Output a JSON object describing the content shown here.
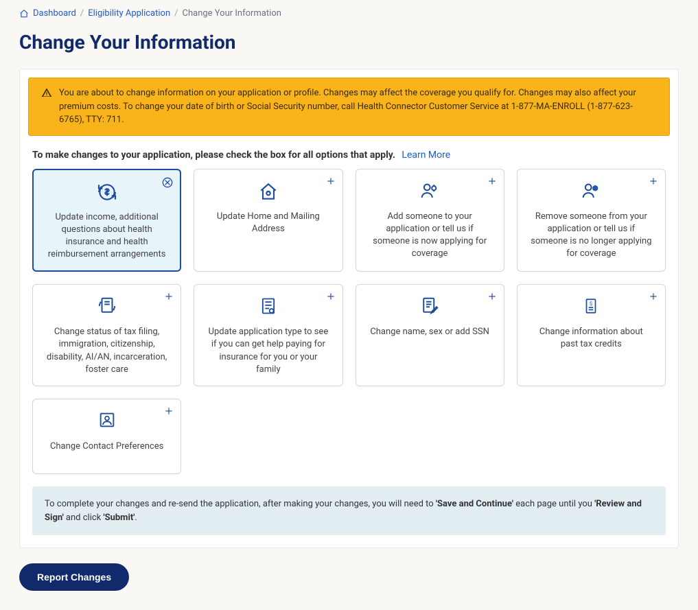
{
  "breadcrumb": {
    "dashboard": "Dashboard",
    "eligibility": "Eligibility Application",
    "current": "Change Your Information"
  },
  "title": "Change Your Information",
  "alert_text": "You are about to change information on your application or profile. Changes may affect the coverage you qualify for. Changes may also affect your premium costs. To change your date of birth or Social Security number, call Health Connector Customer Service at 1-877-MA-ENROLL (1-877-623-6765), TTY: 711.",
  "instructions": "To make changes to your application, please check the box for all options that apply.",
  "learn_more": "Learn More",
  "cards": {
    "income": "Update income, additional questions about health insurance and health reimbursement arrangements",
    "address": "Update Home and Mailing Address",
    "add_person": "Add someone to your application or tell us if someone is now applying for coverage",
    "remove_person": "Remove someone from your application or tell us if someone is no longer applying for coverage",
    "status": "Change status of tax filing, immigration, citizenship, disability, AI/AN, incarceration, foster care",
    "app_type": "Update application type to see if you can get help paying for insurance for you or your family",
    "name_ssn": "Change name, sex or add SSN",
    "tax_credits": "Change information about past tax credits",
    "contact_pref": "Change Contact Preferences"
  },
  "footer": {
    "p1": "To complete your changes and re-send the application, after making your changes, you will need to ",
    "b1": "'Save and Continue'",
    "p2": " each page until you ",
    "b2": "'Review and Sign'",
    "p3": " and click ",
    "b3": "'Submit'",
    "p4": "."
  },
  "button": "Report Changes"
}
